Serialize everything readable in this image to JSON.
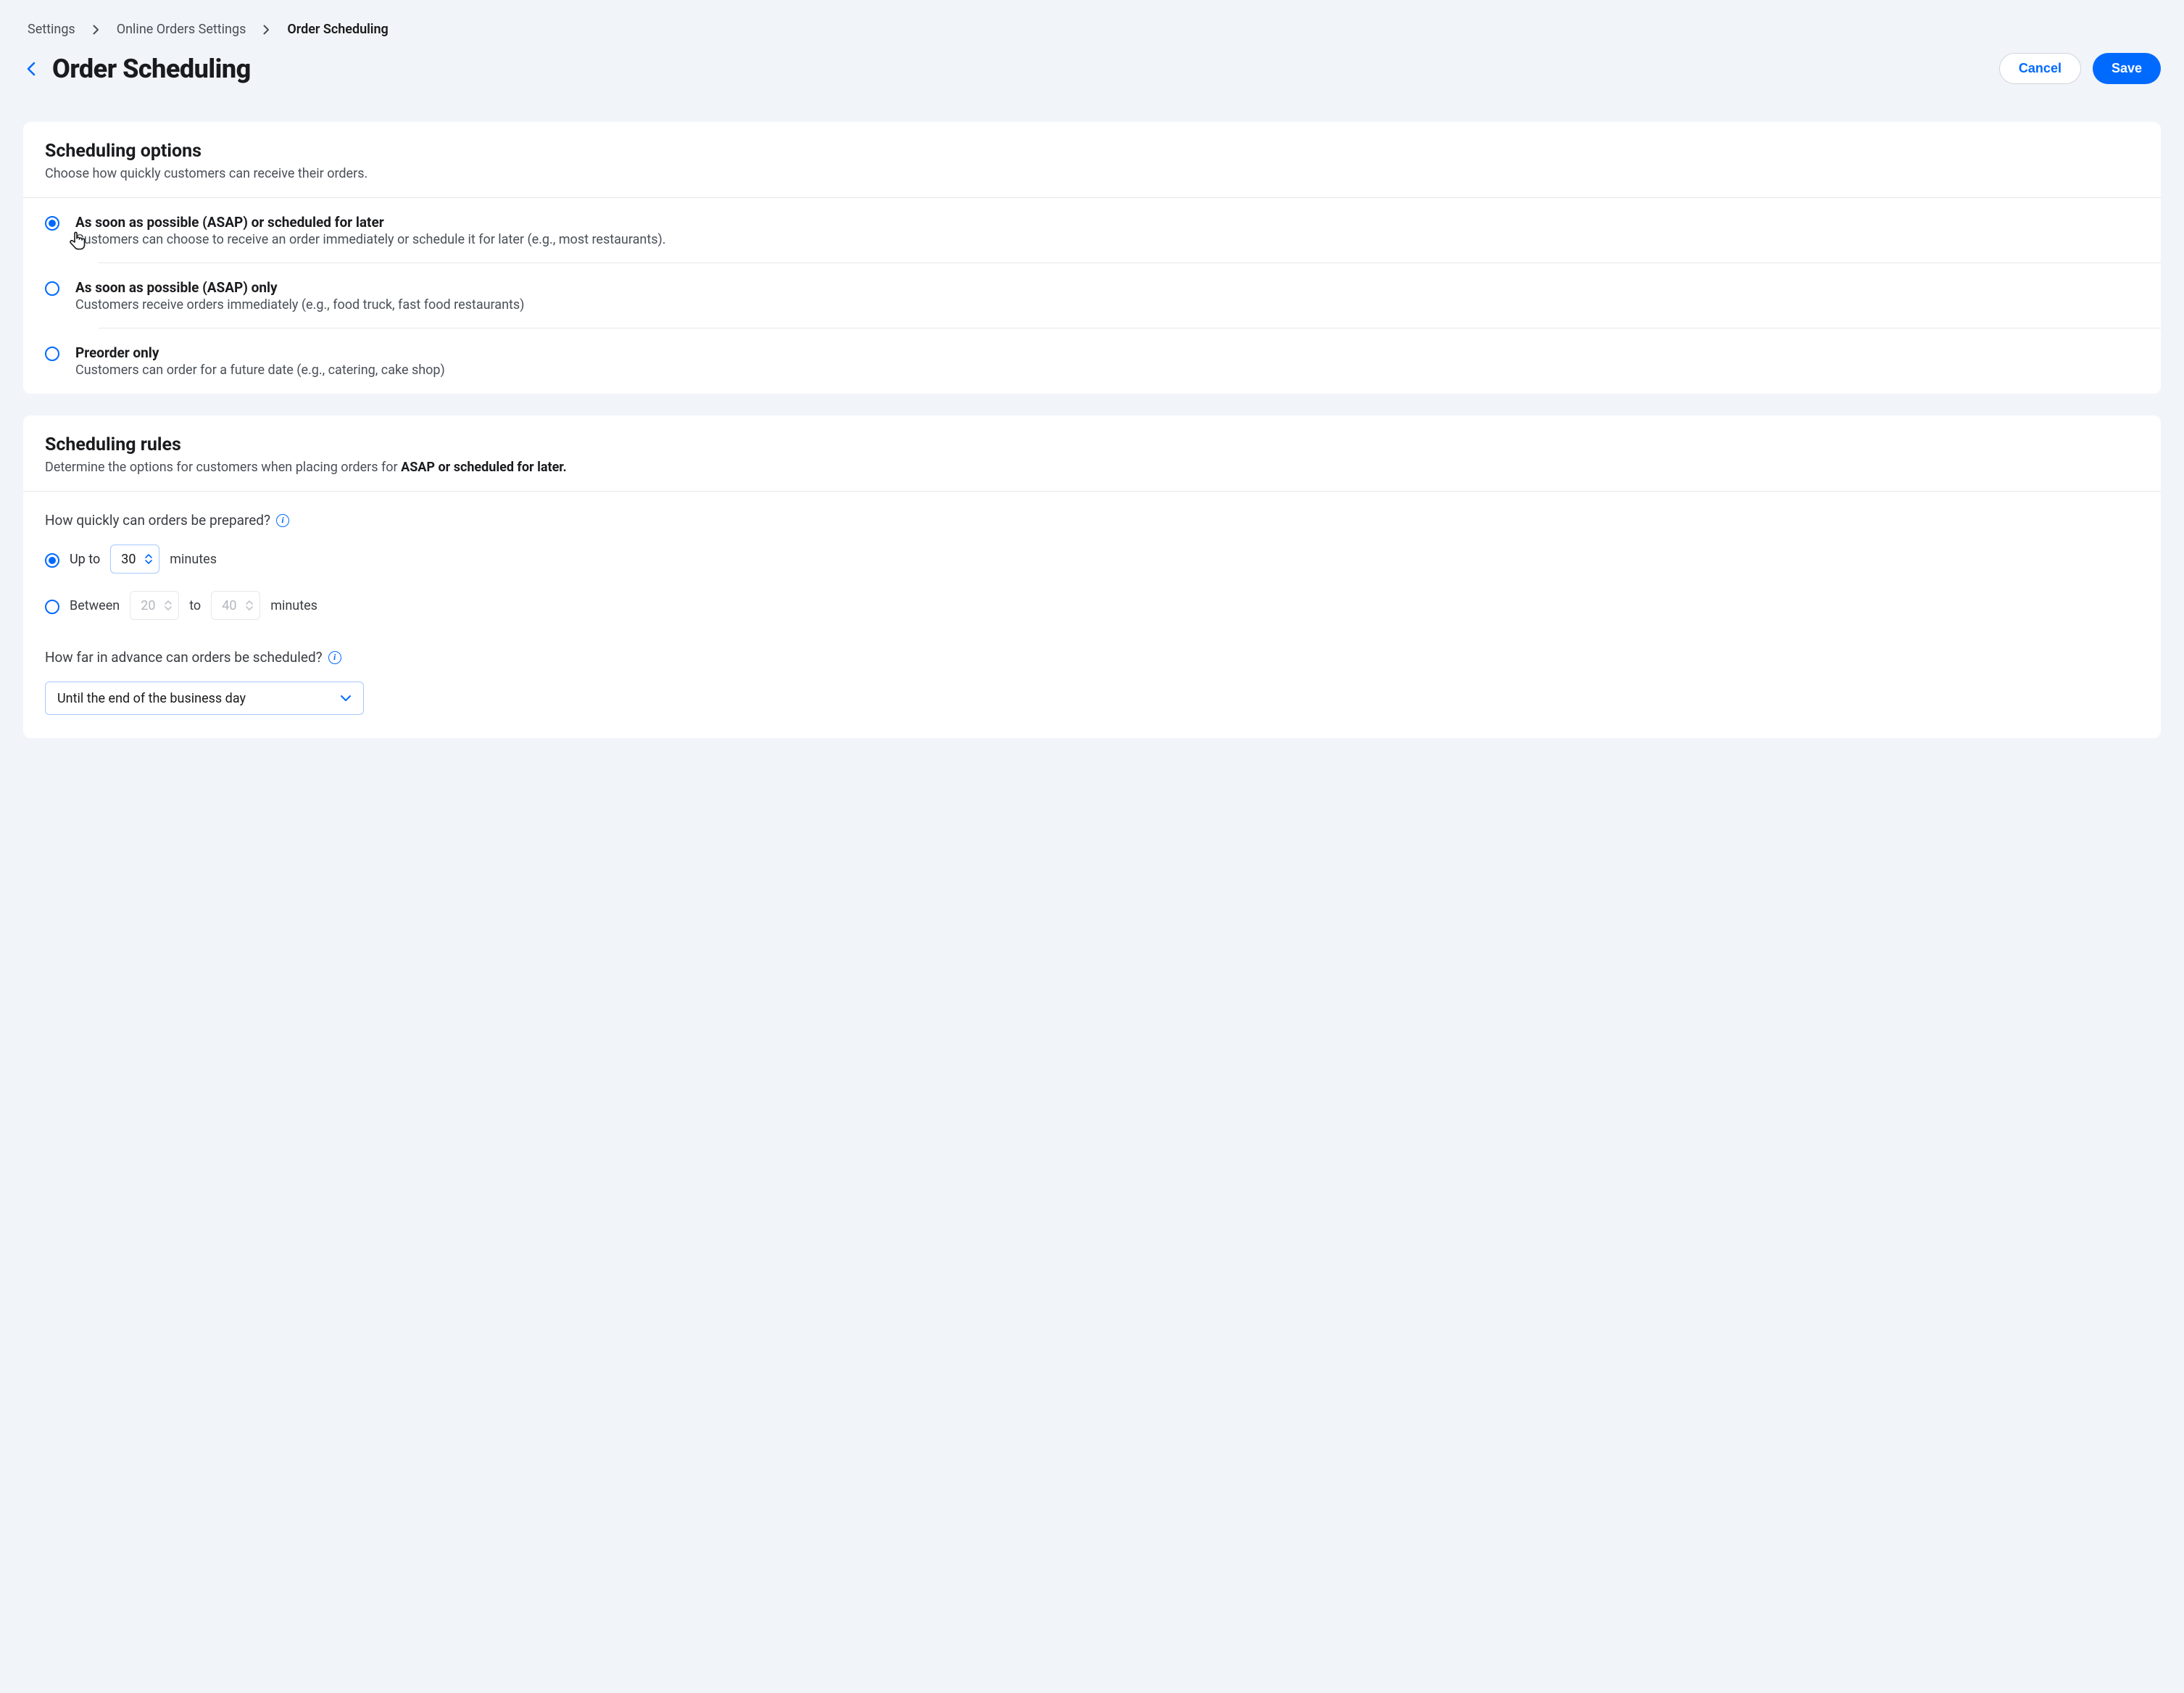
{
  "breadcrumb": {
    "items": [
      "Settings",
      "Online Orders Settings",
      "Order Scheduling"
    ]
  },
  "page_title": "Order Scheduling",
  "actions": {
    "cancel": "Cancel",
    "save": "Save"
  },
  "scheduling_options": {
    "heading": "Scheduling options",
    "subheading": "Choose how quickly customers can receive their orders.",
    "options": [
      {
        "title": "As soon as possible (ASAP) or scheduled for later",
        "desc": "Customers can choose to receive an order immediately or schedule it for later (e.g., most restaurants).",
        "selected": true
      },
      {
        "title": "As soon as possible (ASAP)  only",
        "desc": "Customers receive orders immediately (e.g., food truck, fast food restaurants)",
        "selected": false
      },
      {
        "title": "Preorder only",
        "desc": "Customers can order for a future date (e.g., catering, cake shop)",
        "selected": false
      }
    ]
  },
  "scheduling_rules": {
    "heading": "Scheduling rules",
    "subheading_prefix": "Determine the options for customers when placing orders for ",
    "subheading_bold": "ASAP or scheduled for later.",
    "prep_label": "How quickly can orders be prepared?",
    "upto": {
      "label": "Up to",
      "value": "30",
      "unit": "minutes",
      "selected": true
    },
    "between": {
      "label": "Between",
      "min": "20",
      "to": "to",
      "max": "40",
      "unit": "minutes",
      "selected": false
    },
    "advance_label": "How far in advance can orders be scheduled?",
    "advance_value": "Until the end of the business day"
  }
}
